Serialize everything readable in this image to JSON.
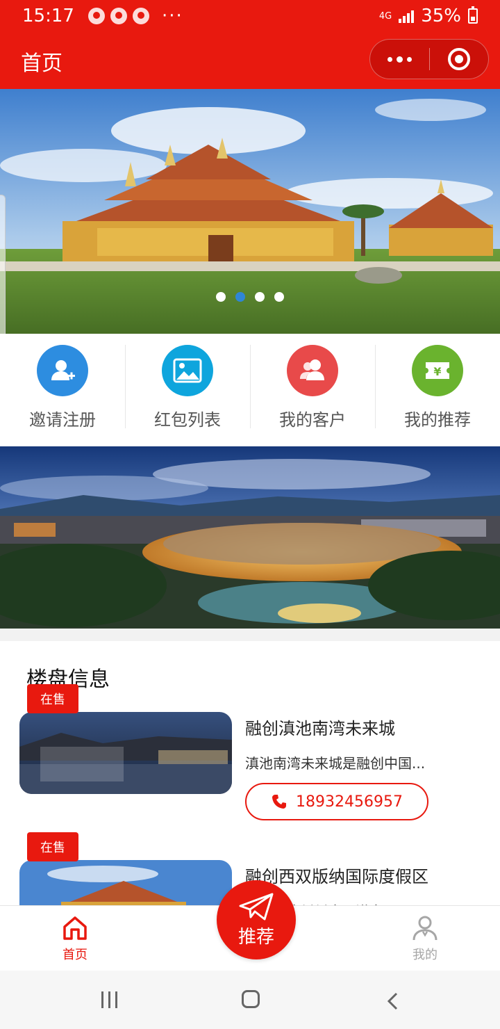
{
  "status_bar": {
    "time": "15:17",
    "more_glyph": "···",
    "network": "4G",
    "battery": "35%"
  },
  "nav": {
    "title": "首页"
  },
  "banner": {
    "slide_count": 4,
    "active_slide": 2
  },
  "quick_menu": [
    {
      "label": "邀请注册",
      "icon": "add-user-icon",
      "color": "#2d8de0"
    },
    {
      "label": "红包列表",
      "icon": "image-icon",
      "color": "#0ea5dd"
    },
    {
      "label": "我的客户",
      "icon": "customers-icon",
      "color": "#e84a4a"
    },
    {
      "label": "我的推荐",
      "icon": "yuan-ticket-icon",
      "color": "#6ab32e"
    }
  ],
  "section": {
    "title": "楼盘信息"
  },
  "properties": [
    {
      "badge": "在售",
      "name": "融创滇池南湾未来城",
      "desc": "滇池南湾未来城是融创中国...",
      "phone": "18932456957"
    },
    {
      "badge": "在售",
      "name": "融创西双版纳国际度假区",
      "desc": "...王自治州州府景洪市..."
    }
  ],
  "tab_bar": {
    "home": "首页",
    "recommend": "推荐",
    "mine": "我的"
  },
  "colors": {
    "brand_red": "#e8190f",
    "active_dot": "#2f86d6",
    "inactive_tab": "#a6a6a6"
  }
}
